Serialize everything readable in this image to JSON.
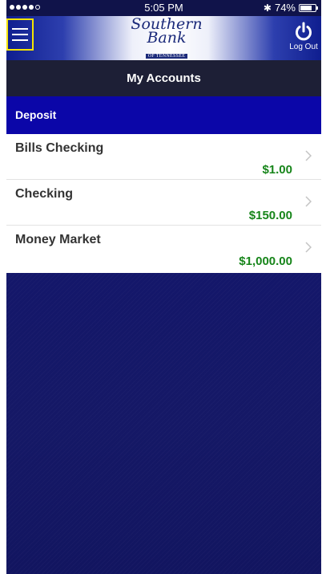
{
  "status_bar": {
    "time": "5:05 PM",
    "battery": "74%",
    "bluetooth_glyph": "✱"
  },
  "header": {
    "logo": {
      "line1": "Southern",
      "line2": "Bank",
      "sub": "OF TENNESSEE"
    },
    "logout_label": "Log Out"
  },
  "title": "My Accounts",
  "section": {
    "label": "Deposit"
  },
  "accounts": [
    {
      "name": "Bills Checking",
      "balance": "$1.00"
    },
    {
      "name": "Checking",
      "balance": "$150.00"
    },
    {
      "name": "Money Market",
      "balance": "$1,000.00"
    }
  ],
  "colors": {
    "navy": "#10134a",
    "deposit_blue": "#0b06a8",
    "balance_green": "#17851a",
    "menu_highlight": "#f5e400"
  },
  "icons": {
    "menu": "hamburger-icon",
    "logout": "power-icon",
    "row_action": "chevron-right-icon",
    "bluetooth": "bluetooth-icon",
    "battery": "battery-icon"
  }
}
